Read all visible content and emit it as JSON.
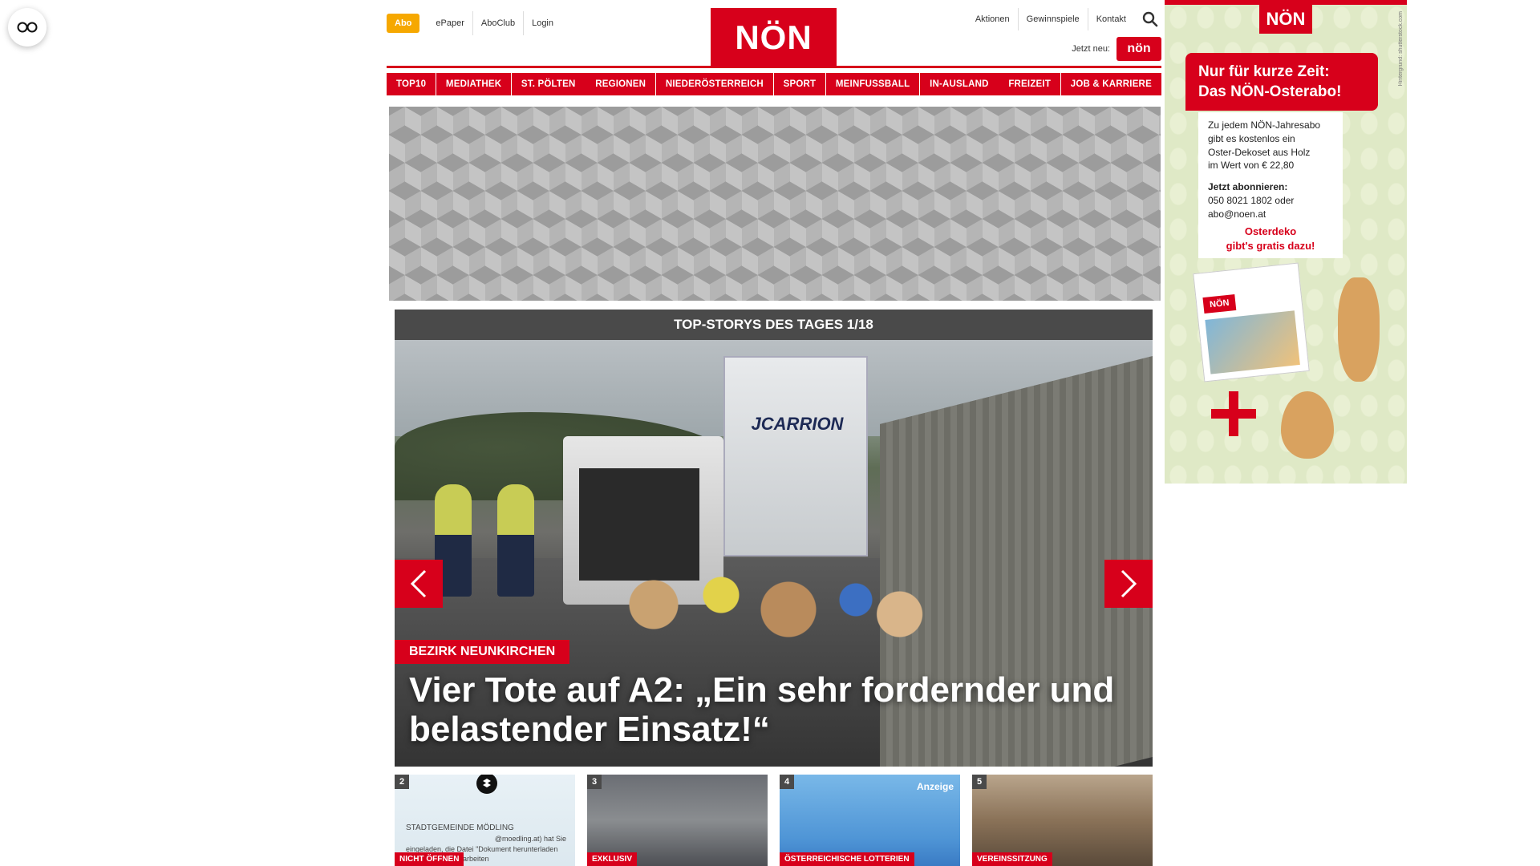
{
  "header": {
    "abo_label": "Abo",
    "left_links": [
      "ePaper",
      "AboClub",
      "Login"
    ],
    "logo_text": "NÖN",
    "right_links": [
      "Aktionen",
      "Gewinnspiele",
      "Kontakt"
    ],
    "jetzt_neu_label": "Jetzt neu:",
    "jetzt_logo_text": "nön"
  },
  "nav": {
    "items": [
      "Top10",
      "Mediathek",
      "St. Pölten",
      "Regionen",
      "Niederösterreich",
      "Sport",
      "Meinfussball",
      "In-Ausland",
      "Freizeit",
      "Job & Karriere"
    ]
  },
  "slider": {
    "heading": "Top-Storys des Tages 1/18",
    "truck_text": "JCARRION",
    "badge": "Bezirk Neunkirchen",
    "title": "Vier Tote auf A2: „Ein sehr fordernder und belastender Einsatz!“"
  },
  "thumbs": [
    {
      "num": "2",
      "tag": "Nicht öffnen",
      "doc_line1": "STADTGEMEINDE MÖDLING",
      "doc_line2": "@moedling.at) hat Sie",
      "doc_line3": "eingeladen, die Datei \"Dokument herunterladen",
      "doc_line4": "Adobe PDF zu bearbeiten"
    },
    {
      "num": "3",
      "tag": "Exklusiv"
    },
    {
      "num": "4",
      "tag": "Österreichische Lotterien",
      "ad_label": "Anzeige"
    },
    {
      "num": "5",
      "tag": "Vereinssitzung"
    }
  ],
  "side_ad": {
    "logo": "NÖN",
    "vertical_text": "Hintergrund: shutterstock.com",
    "banner_line1": "Nur für kurze Zeit:",
    "banner_line2": "Das NÖN-Osterabo!",
    "box_line1": "Zu jedem NÖN-Jahresabo",
    "box_line2": "gibt es kostenlos ein",
    "box_line3": "Oster-Dekoset aus Holz",
    "box_line4": "im Wert von € 22,80",
    "box_heading": "Jetzt abonnieren:",
    "box_phone": "050 8021 1802 oder",
    "box_email": "abo@noen.at",
    "red_line1": "Osterdeko",
    "red_line2": "gibt's gratis dazu!",
    "paper_logo": "NÖN"
  },
  "colors": {
    "brand_red": "#d7001b",
    "abo_orange": "#f6a800",
    "slider_head": "#4a4a4a"
  }
}
